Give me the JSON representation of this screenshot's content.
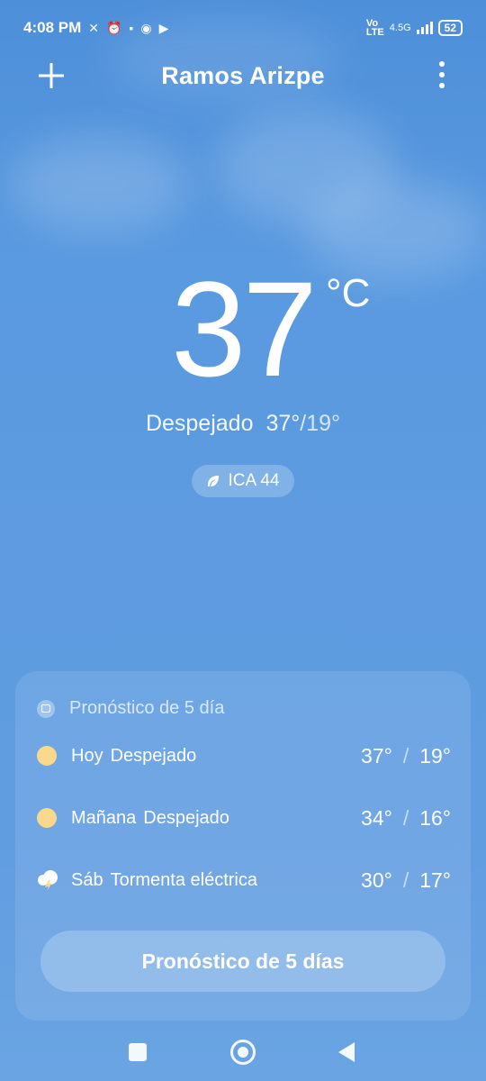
{
  "status_bar": {
    "time": "4:08 PM",
    "network_label_top": "Vo",
    "network_label_bottom": "LTE",
    "network_type": "4.5G",
    "battery": "52"
  },
  "header": {
    "add_icon": "plus-icon",
    "city": "Ramos Arizpe",
    "menu_icon": "more-vertical-icon"
  },
  "current": {
    "temperature": "37",
    "unit": "°C",
    "condition": "Despejado",
    "high": "37°",
    "low": "19°",
    "aqi_label": "ICA 44"
  },
  "forecast": {
    "title": "Pronóstico de 5 día",
    "rows": [
      {
        "day": "Hoy",
        "condition": "Despejado",
        "high": "37°",
        "low": "19°",
        "icon": "sun-icon"
      },
      {
        "day": "Mañana",
        "condition": "Despejado",
        "high": "34°",
        "low": "16°",
        "icon": "sun-icon"
      },
      {
        "day": "Sáb",
        "condition": "Tormenta eléctrica",
        "high": "30°",
        "low": "17°",
        "icon": "thunderstorm-icon"
      }
    ],
    "button_label": "Pronóstico de 5 días"
  },
  "colors": {
    "sky_top": "#4d8fd9",
    "sky_bottom": "#6aa4e3",
    "sun": "#fbd98c"
  }
}
